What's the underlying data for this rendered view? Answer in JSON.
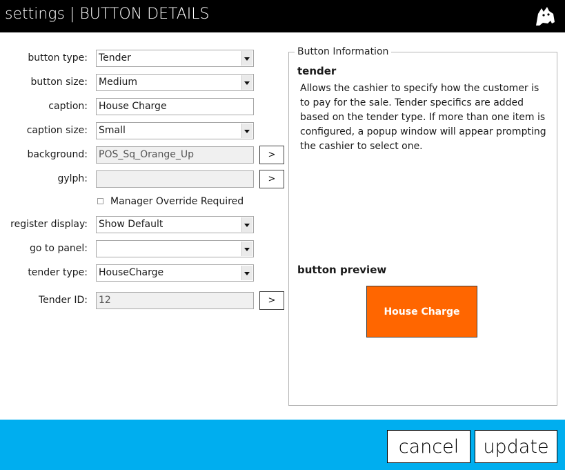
{
  "header": {
    "title": "settings | BUTTON DETAILS",
    "logo_icon": "cat-head-logo-icon"
  },
  "form": {
    "button_type": {
      "label": "button type:",
      "value": "Tender"
    },
    "button_size": {
      "label": "button size:",
      "value": "Medium"
    },
    "caption": {
      "label": "caption:",
      "value": "House Charge"
    },
    "caption_size": {
      "label": "caption size:",
      "value": "Small"
    },
    "background": {
      "label": "background:",
      "value": "POS_Sq_Orange_Up",
      "browse_label": ">"
    },
    "glyph": {
      "label": "gylph:",
      "value": "",
      "browse_label": ">"
    },
    "manager_override": {
      "label": "Manager Override Required",
      "checked": false
    },
    "register_display": {
      "label": "register display:",
      "value": "Show Default"
    },
    "go_to_panel": {
      "label": "go to panel:",
      "value": ""
    },
    "tender_type": {
      "label": "tender type:",
      "value": "HouseCharge"
    },
    "tender_id": {
      "label": "Tender ID:",
      "value": "12",
      "browse_label": ">"
    }
  },
  "info": {
    "legend": "Button Information",
    "type_heading": "tender",
    "description": "Allows the cashier to specify how the customer is to pay for the sale. Tender specifics are added based on the tender type. If more than one item is configured, a popup window will appear prompting the cashier to select one.",
    "preview_label": "button preview",
    "preview_caption": "House Charge",
    "preview_color": "#ff6600"
  },
  "footer": {
    "color": "#00aeef",
    "cancel_label": "cancel",
    "update_label": "update"
  }
}
